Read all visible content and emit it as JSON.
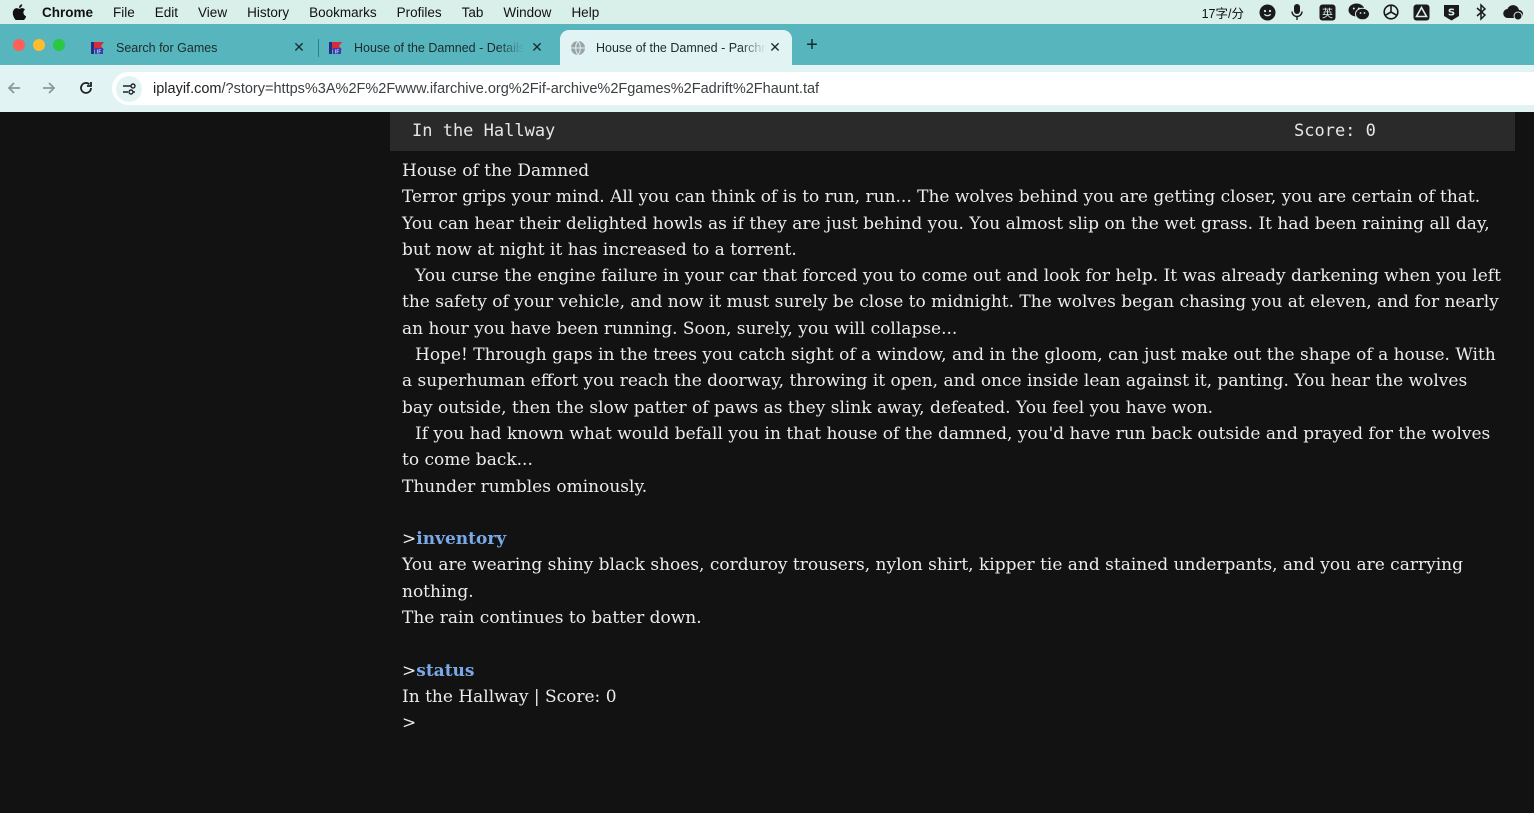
{
  "menubar": {
    "items": [
      "Chrome",
      "File",
      "Edit",
      "View",
      "History",
      "Bookmarks",
      "Profiles",
      "Tab",
      "Window",
      "Help"
    ],
    "status_text": "17字/分",
    "ime_label": "英",
    "tray_icons": [
      "face-icon",
      "microphone-icon",
      "ime-icon",
      "wechat-icon",
      "openai-icon",
      "drive-icon",
      "s-app-icon",
      "bluetooth-icon",
      "cloud-icon"
    ]
  },
  "tabs": [
    {
      "title": "Search for Games",
      "favicon": "ifdb-icon",
      "active": false
    },
    {
      "title": "House of the Damned - Details",
      "favicon": "ifdb-icon",
      "active": false
    },
    {
      "title": "House of the Damned - Parchment",
      "favicon": "globe-icon",
      "active": true
    }
  ],
  "toolbar": {
    "url_host": "iplayif.com",
    "url_rest": "/?story=https%3A%2F%2Fwww.ifarchive.org%2Fif-archive%2Fgames%2Fadrift%2Fhaunt.taf"
  },
  "game": {
    "status_location": "In the Hallway",
    "status_score": "Score: 0",
    "title": "House of the Damned",
    "intro": [
      "Terror grips your mind. All you can think of is to run, run... The wolves behind you are getting closer, you are certain of that. You can hear their delighted howls as if they are just behind you. You almost slip on the wet grass. It had been raining all day, but now at night it has increased to a torrent.",
      "You curse the engine failure in your car that forced you to come out and look for help. It was already darkening when you left the safety of your vehicle, and now it must surely be close to midnight. The wolves began chasing you at eleven, and for nearly an hour you have been running. Soon, surely, you will collapse...",
      "Hope! Through gaps in the trees you catch sight of a window, and in the gloom, can just make out the shape of a house. With a superhuman effort you reach the doorway, throwing it open, and once inside lean against it, panting. You hear the wolves bay outside, then the slow patter of paws as they slink away, defeated. You feel you have won.",
      "If you had known what would befall you in that house of the damned, you'd have run back outside and prayed for the wolves to come back..."
    ],
    "intro_tail": "Thunder rumbles ominously.",
    "prompt_char": ">",
    "command1": "inventory",
    "response1a": "You are wearing shiny black shoes, corduroy trousers, nylon shirt, kipper tie and stained underpants, and you are carrying nothing.",
    "response1b": "The rain continues to batter down.",
    "command2": "status",
    "response2": "In the Hallway | Score: 0"
  }
}
